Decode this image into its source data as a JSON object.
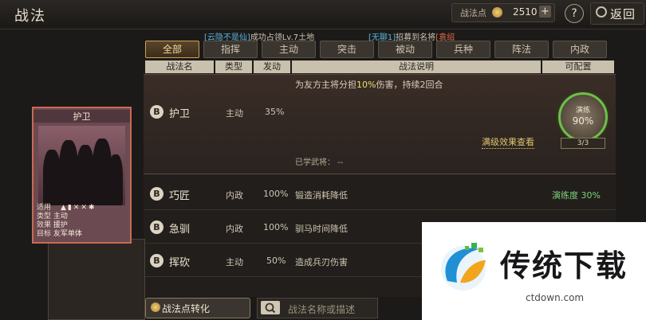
{
  "header": {
    "title": "战法",
    "points_label": "战法点",
    "points_value": "2510",
    "plus": "+",
    "help": "?",
    "back": "返回"
  },
  "news": [
    {
      "tag": "[云隐不是仙]",
      "text": "成功占领Lv.7土地"
    },
    {
      "tag": "[无聊1]",
      "text": "招募到名将",
      "tag2": "[袁绍"
    }
  ],
  "tabs": [
    "全部",
    "指挥",
    "主动",
    "突击",
    "被动",
    "兵种",
    "阵法",
    "内政"
  ],
  "columns": [
    "战法名",
    "类型",
    "发动",
    "战法说明",
    "可配置"
  ],
  "selected": {
    "grade": "B",
    "name": "护卫",
    "type": "主动",
    "rate": "35%",
    "desc_a": "为友方主将分担",
    "desc_hl": "10%",
    "desc_b": "伤害，持续2回合",
    "dial_label": "演练",
    "dial_pct": "90%",
    "count": "3/3",
    "mastery_link": "满级效果查看",
    "learned": "已学武将： --"
  },
  "rows": [
    {
      "grade": "B",
      "name": "巧匠",
      "type": "内政",
      "rate": "100%",
      "desc": "锻造消耗降低",
      "skill": "演练度 30%"
    },
    {
      "grade": "B",
      "name": "急驯",
      "type": "内政",
      "rate": "100%",
      "desc": "驯马时间降低",
      "skill": ""
    },
    {
      "grade": "B",
      "name": "挥砍",
      "type": "主动",
      "rate": "50%",
      "desc": "造成兵刃伤害",
      "skill": ""
    }
  ],
  "card": {
    "title": "护卫",
    "meta": [
      {
        "k": "适用",
        "v": ""
      },
      {
        "k": "类型",
        "v": "主动"
      },
      {
        "k": "效果",
        "v": "援护"
      },
      {
        "k": "目标",
        "v": "友军单体"
      }
    ],
    "icons": "▲▮✕✕✱"
  },
  "bottom": {
    "convert": "战法点转化",
    "search_placeholder": "战法名称或描述"
  },
  "watermark": {
    "title": "传统下载",
    "url": "ctdown.com"
  }
}
